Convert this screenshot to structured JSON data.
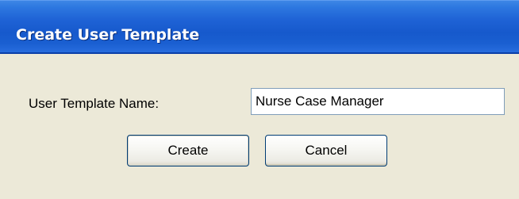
{
  "window": {
    "title": "Create User Template"
  },
  "form": {
    "template_name_label": "User Template Name:",
    "template_name_value": "Nurse Case Manager"
  },
  "buttons": {
    "create_label": "Create",
    "cancel_label": "Cancel"
  },
  "colors": {
    "titlebar": "#1f63d6",
    "dialog_background": "#ece9d8",
    "input_border": "#7f9db9",
    "button_border": "#003c74"
  }
}
